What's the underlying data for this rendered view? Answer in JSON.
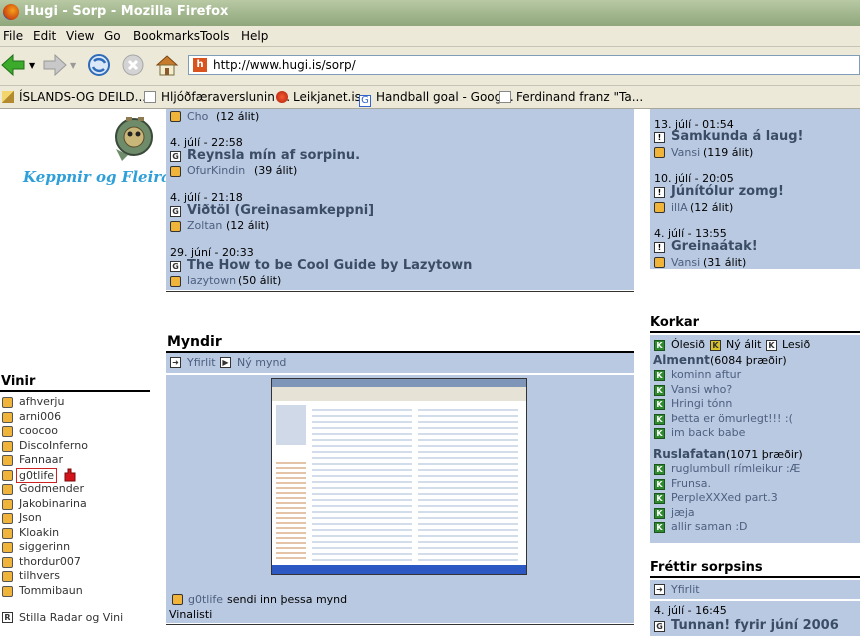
{
  "window": {
    "title": "Hugi - Sorp - Mozilla Firefox"
  },
  "menu": [
    "File",
    "Edit",
    "View",
    "Go",
    "Bookmarks",
    "Tools",
    "Help"
  ],
  "url": "http://www.hugi.is/sorp/",
  "bookmarks": [
    "ÍSLANDS-OG DEILD...",
    "Hljóðfæraverslunin ...",
    "Leikjanet.is",
    "Handball goal - Goog...",
    "Ferdinand franz \"Ta..."
  ],
  "logo_text": "Keppnir og Fleira!",
  "center_top": {
    "first_user": "Cho",
    "first_count": "(12 álit)",
    "items": [
      {
        "date": "4. júlí - 22:58",
        "title": "Reynsla mín af sorpinu.",
        "user": "OfurKindin",
        "count": "(39 álit)"
      },
      {
        "date": "4. júlí - 21:18",
        "title": "Viðtöl (Greinasamkeppni]",
        "user": "Zoltan",
        "count": "(12 álit)"
      },
      {
        "date": "29. júní - 20:33",
        "title": "The How to be Cool Guide by Lazytown",
        "user": "lazytown",
        "count": "(50 álit)"
      }
    ]
  },
  "right_top": [
    {
      "date": "13. júlí - 01:54",
      "title": "Samkunda á laug!",
      "user": "Vansi",
      "count": "(119 álit)"
    },
    {
      "date": "10. júlí - 20:05",
      "title": "Júnítólur zomg!",
      "user": "illA",
      "count": "(12 álit)"
    },
    {
      "date": "4. júlí - 13:55",
      "title": "Greinaátak!",
      "user": "Vansi",
      "count": "(31 álit)"
    }
  ],
  "myndir": {
    "heading": "Myndir",
    "overview": "Yfirlit",
    "new_image": "Ný mynd",
    "caption_user": "g0tlife",
    "caption_text": "sendi inn þessa mynd",
    "vinalisti": "Vinalisti"
  },
  "vinir": {
    "heading": "Vinir",
    "friends": [
      "afhverju",
      "arni006",
      "coocoo",
      "DiscoInferno",
      "Fannaar",
      "g0tlife",
      "Godmender",
      "Jakobinarina",
      "Json",
      "Kloakin",
      "siggerinn",
      "thordur007",
      "tilhvers",
      "Tommibaun"
    ],
    "settings": "Stilla Radar og Vini"
  },
  "korkar": {
    "heading": "Korkar",
    "legend": [
      "Ólesið",
      "Ný álit",
      "Lesið"
    ],
    "groups": [
      {
        "name": "Almennt",
        "count": "(6084 þræðir)",
        "threads": [
          "kominn aftur",
          "Vansi who?",
          "Hringi tónn",
          "Þetta er ömurlegt!!! :(",
          "im back babe"
        ]
      },
      {
        "name": "Ruslafatan",
        "count": "(1071 þræðir)",
        "threads": [
          "ruglumbull rímleikur :Æ",
          "Frunsa.",
          "PerpleXXXed part.3",
          "jæja",
          "allir saman :D"
        ]
      }
    ]
  },
  "frettir": {
    "heading": "Fréttir sorpsins",
    "overview": "Yfirlit",
    "date": "4. júlí - 16:45",
    "title": "Tunnan! fyrir júní 2006"
  },
  "colors": {
    "panel": "#b9c9e1",
    "title": "#3b4d66",
    "user": "#4d5f80",
    "green_icon": "#2f8a2f"
  }
}
